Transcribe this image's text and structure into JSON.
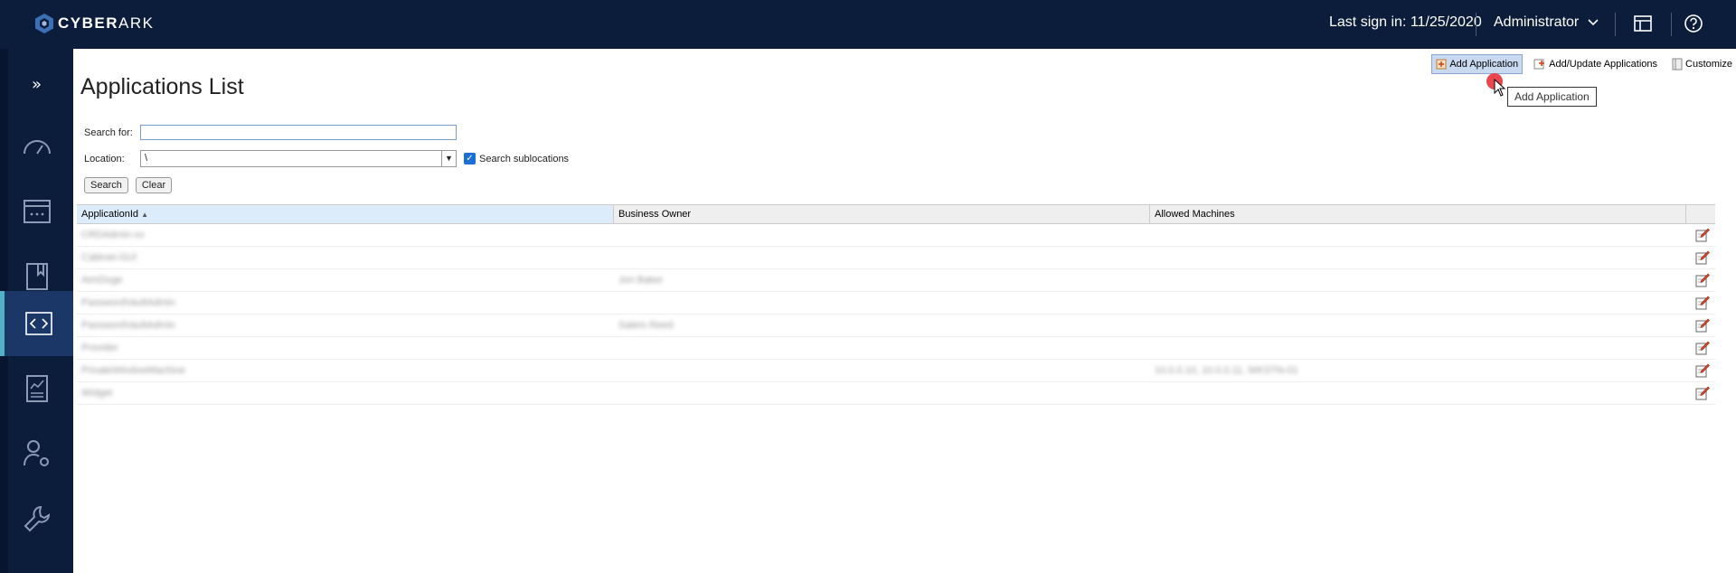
{
  "brand": {
    "name_bold": "CYBER",
    "name_rest": "ARK"
  },
  "header": {
    "last_sign_in": "Last sign in: 11/25/2020",
    "user": "Administrator"
  },
  "page": {
    "title": "Applications List"
  },
  "toolbar": {
    "add_application": "Add Application",
    "add_update_applications": "Add/Update Applications",
    "customize": "Customize"
  },
  "tooltip": "Add Application",
  "form": {
    "search_label": "Search for:",
    "search_value": "",
    "location_label": "Location:",
    "location_value": "\\",
    "sublocations_label": "Search sublocations",
    "sublocations_checked": true,
    "search_button": "Search",
    "clear_button": "Clear"
  },
  "table": {
    "columns": [
      "ApplicationId",
      "Business Owner",
      "Allowed Machines"
    ],
    "rows": [
      [
        "CRDAdmin-xx",
        "",
        ""
      ],
      [
        "Cabinet-GUI",
        "",
        ""
      ],
      [
        "AimDoge",
        "Jon Baker",
        ""
      ],
      [
        "PasswordVaultAdmin",
        "",
        ""
      ],
      [
        "PasswordVaultAdmin",
        "Salem Reed",
        ""
      ],
      [
        "Provider",
        "",
        ""
      ],
      [
        "PrivateWindowMachine",
        "",
        "10.0.0.10, 10.0.0.11, WKSTN-01"
      ],
      [
        "Widget",
        "",
        ""
      ]
    ]
  },
  "colors": {
    "nav_bg": "#0c1d3b",
    "nav_active": "#1b3768",
    "accent": "#4fb3c5"
  }
}
